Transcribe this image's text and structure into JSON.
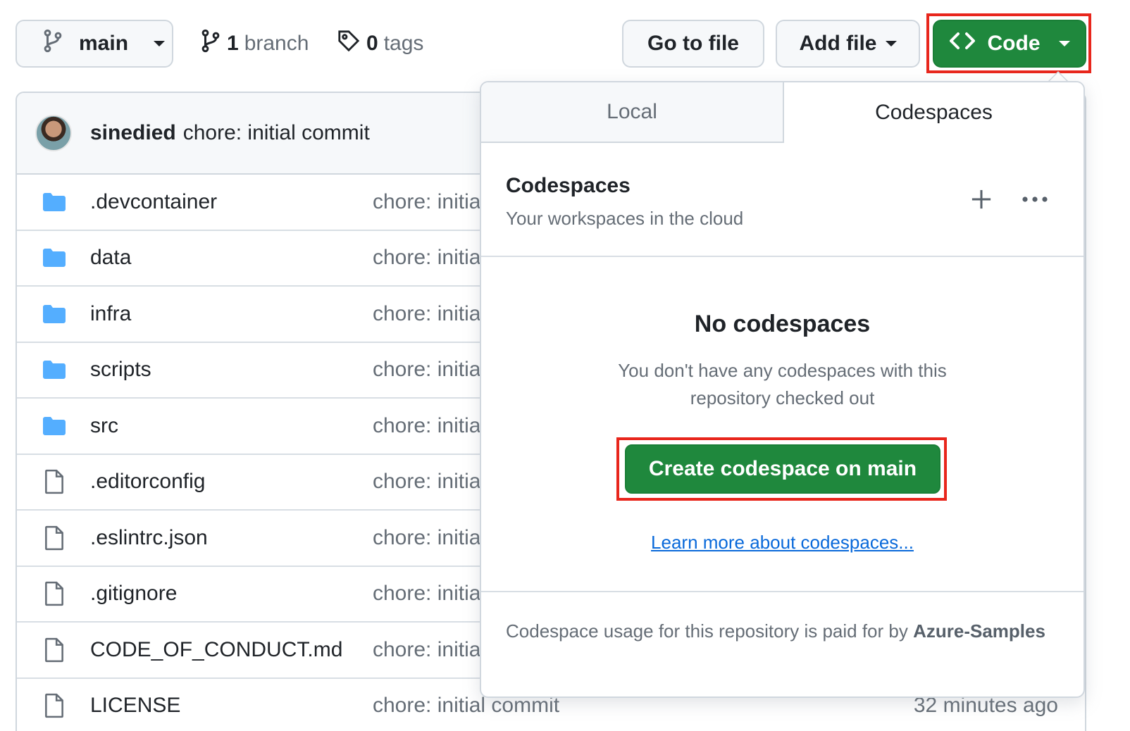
{
  "toolbar": {
    "branch_name": "main",
    "branch_count": "1",
    "branch_label": "branch",
    "tag_count": "0",
    "tag_label": "tags",
    "goto_file_label": "Go to file",
    "add_file_label": "Add file",
    "code_label": "Code"
  },
  "commit": {
    "author": "sinedied",
    "message": "chore: initial commit"
  },
  "files": [
    {
      "name": ".devcontainer",
      "type": "folder",
      "commit": "chore: initial commit",
      "time": ""
    },
    {
      "name": "data",
      "type": "folder",
      "commit": "chore: initial commit",
      "time": ""
    },
    {
      "name": "infra",
      "type": "folder",
      "commit": "chore: initial commit",
      "time": ""
    },
    {
      "name": "scripts",
      "type": "folder",
      "commit": "chore: initial commit",
      "time": ""
    },
    {
      "name": "src",
      "type": "folder",
      "commit": "chore: initial commit",
      "time": ""
    },
    {
      "name": ".editorconfig",
      "type": "file",
      "commit": "chore: initial commit",
      "time": ""
    },
    {
      "name": ".eslintrc.json",
      "type": "file",
      "commit": "chore: initial commit",
      "time": ""
    },
    {
      "name": ".gitignore",
      "type": "file",
      "commit": "chore: initial commit",
      "time": ""
    },
    {
      "name": "CODE_OF_CONDUCT.md",
      "type": "file",
      "commit": "chore: initial commit",
      "time": ""
    },
    {
      "name": "LICENSE",
      "type": "file",
      "commit": "chore: initial commit",
      "time": "32 minutes ago"
    }
  ],
  "dropdown": {
    "tabs": {
      "local": "Local",
      "codespaces": "Codespaces"
    },
    "section_title": "Codespaces",
    "section_subtitle": "Your workspaces in the cloud",
    "plus_icon": "plus-icon",
    "more_icon": "kebab-horizontal-icon",
    "empty_title": "No codespaces",
    "empty_description": "You don't have any codespaces with this repository checked out",
    "create_button": "Create codespace on main",
    "learn_more": "Learn more about codespaces...",
    "footer_text": "Codespace usage for this repository is paid for by",
    "footer_owner": "Azure-Samples"
  },
  "colors": {
    "accent_green": "#1f883d",
    "link_blue": "#0969da",
    "folder_blue": "#54aeff",
    "highlight_red": "#e8261c"
  }
}
